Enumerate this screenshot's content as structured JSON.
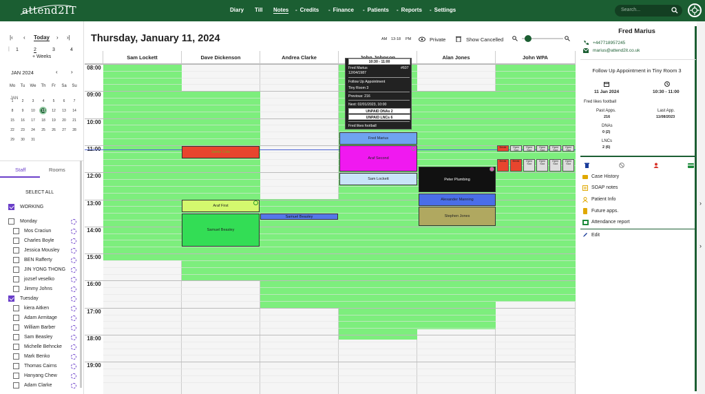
{
  "app": {
    "logo": "attend2IT"
  },
  "nav": {
    "items": [
      "Diary",
      "Till",
      "Notes",
      "Credits",
      "Finance",
      "Patients",
      "Reports",
      "Settings"
    ],
    "search_placeholder": "Search..."
  },
  "left": {
    "today": "Today",
    "week_nums": [
      "1",
      "2",
      "3",
      "4"
    ],
    "plus_weeks": "+ Weeks",
    "month_label": "JAN 2024",
    "weekdays": [
      "Mo",
      "Tu",
      "We",
      "Th",
      "Fr",
      "Sa",
      "Su"
    ],
    "month_abbr": "JAN",
    "weeks": [
      [
        "",
        "",
        "",
        "",
        "",
        "",
        ""
      ],
      [
        "1",
        "2",
        "3",
        "4",
        "5",
        "6",
        "7"
      ],
      [
        "8",
        "9",
        "10",
        "11",
        "12",
        "13",
        "14"
      ],
      [
        "15",
        "16",
        "17",
        "18",
        "19",
        "20",
        "21"
      ],
      [
        "22",
        "23",
        "24",
        "25",
        "26",
        "27",
        "28"
      ],
      [
        "29",
        "30",
        "31",
        "",
        "",
        "",
        ""
      ]
    ],
    "tabs": {
      "staff": "Staff",
      "rooms": "Rooms"
    },
    "select_all": "SELECT ALL",
    "working": "WORKING",
    "groups": [
      {
        "day": "Monday",
        "checked": false,
        "staff": [
          "Mos Craciun",
          "Charles Boyle",
          "Jessica Mousley",
          "BEN Rafferty",
          "JIN YONG THONG",
          "jozsef veselko",
          "Jimmy Johns"
        ]
      },
      {
        "day": "Tuesday",
        "checked": true,
        "staff": [
          "kiera Aitken",
          "Adam Armitage",
          "William Barber",
          "Sam Beasley",
          "Michelle Behncke",
          "Mark Benko",
          "Thomas Cairns",
          "Hanyang Chew",
          "Adam Clarke"
        ]
      }
    ]
  },
  "calendar": {
    "title": "Thursday, January 11, 2024",
    "am": "AM",
    "hours24": "13-18",
    "pm": "PM",
    "private_label": "Private",
    "show_cancelled": "Show Cancelled",
    "zoom": 0.15,
    "columns": [
      "Sam Lockett",
      "Dave Dickenson",
      "Andrea Clarke",
      "John Johnson",
      "Alan Jones",
      "John WPA"
    ],
    "times": [
      "08:00",
      "09:00",
      "10:00",
      "11:00",
      "12:00",
      "13:00",
      "14:00",
      "15:00",
      "16:00",
      "17:00",
      "18:00",
      "19:00"
    ],
    "appointments": [
      {
        "label": "Fred Marius"
      },
      {
        "label": "Araf Second"
      },
      {
        "label": "Sam Lockett"
      },
      {
        "label": "Araf First"
      },
      {
        "label": "Samuel Beasley"
      },
      {
        "label": "Samuel Beasley"
      },
      {
        "label": "Peter Plumbing"
      },
      {
        "label": "Alexander Manning"
      },
      {
        "label": "Stephen Jones"
      },
      {
        "label": "Jamie Cole"
      }
    ],
    "mini_slots": [
      "Break",
      "Open Slot",
      "Open Slot",
      "Open Slot",
      "Open Slot",
      "Open Slot",
      "Break",
      "Break",
      "Open Slot",
      "Open Slot",
      "Open Slot",
      "Open Slot"
    ],
    "popup": {
      "time": "10:30 - 11:00",
      "name": "Fred Marius",
      "id": "#607",
      "dob": "12/04/1987",
      "type": "Follow Up Appointment",
      "room": "Tiny Room 3",
      "previous": "Previous: 216",
      "next": "Next: 02/01/2023, 10:00",
      "unpaid_dna": "UNPAID DNAs 2",
      "unpaid_lnc": "UNPAID LNCs 6",
      "note": "Fred likes football"
    }
  },
  "right": {
    "name": "Fred Marius",
    "phone": "+447718957245",
    "email": "marius@attend2it.co.uk",
    "appt_title": "Follow Up Appointment in Tiny Room 3",
    "date": "11 Jan 2024",
    "time": "10:30 - 11:00",
    "note": "Fred likes football",
    "past_label": "Past Apps.",
    "past_value": "216",
    "last_label": "Last App.",
    "last_value": "11/08/2023",
    "dna_label": "DNAs",
    "dna_value": "0 (2)",
    "lnc_label": "LNCs",
    "lnc_value": "2 (6)",
    "menu": [
      "Case History",
      "SOAP notes",
      "Patient Info",
      "Future apps.",
      "Attendance report",
      "Edit"
    ]
  },
  "colors": {
    "brand": "#1b5e32",
    "available": "#7dee7d",
    "accent": "#6a3ec9"
  }
}
